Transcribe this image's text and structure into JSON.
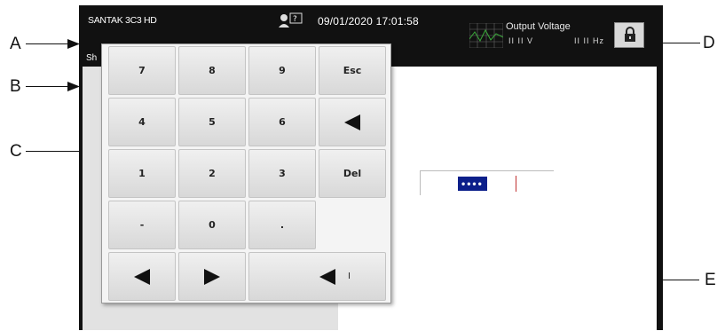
{
  "callouts": {
    "a": "A",
    "b": "B",
    "c": "C",
    "d": "D",
    "e": "E"
  },
  "status_bar": {
    "device_name": "SANTAK 3C3 HD",
    "datetime": "09/01/2020 17:01:58",
    "user_help_icon": "user-question-icon",
    "output_title": "Output Voltage",
    "output_voltage_value": "II II V",
    "output_frequency_value": "II II Hz",
    "lock_icon": "lock-icon"
  },
  "title_row": {
    "stub": "Sh"
  },
  "password_field": {
    "masked_value": "••••"
  },
  "keypad": {
    "rows": [
      [
        "7",
        "8",
        "9",
        "Esc"
      ],
      [
        "4",
        "5",
        "6",
        "backspace-icon"
      ],
      [
        "1",
        "2",
        "3",
        "Del"
      ],
      [
        "-",
        "0",
        "."
      ]
    ],
    "bottom_row": [
      "arrow-left-icon",
      "arrow-right-icon",
      "backspace-icon"
    ],
    "keys": {
      "k7": "7",
      "k8": "8",
      "k9": "9",
      "esc": "Esc",
      "k4": "4",
      "k5": "5",
      "k6": "6",
      "k1": "1",
      "k2": "2",
      "k3": "3",
      "del": "Del",
      "minus": "-",
      "k0": "0",
      "dot": "."
    },
    "backspace_mark": "I"
  },
  "colors": {
    "status_bar": "#111111",
    "mask_background": "#0c1f8a",
    "keypad_background": "#f4f4f4",
    "left_panel": "#e2e2e2"
  }
}
